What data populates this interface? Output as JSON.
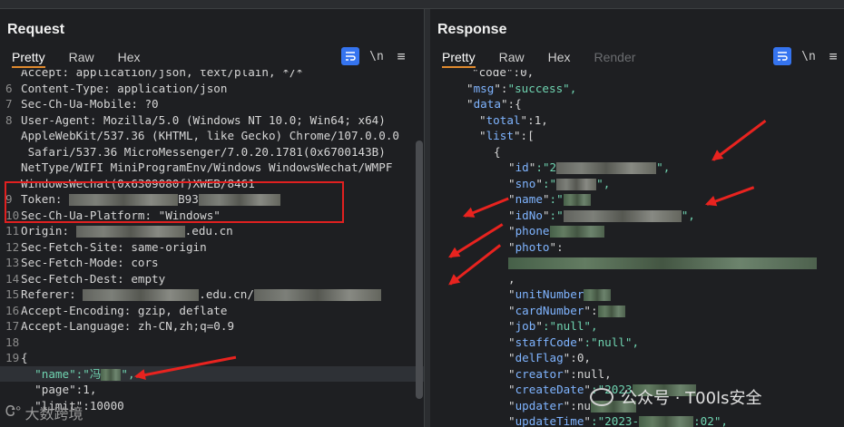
{
  "request": {
    "title": "Request",
    "tabs": [
      "Pretty",
      "Raw",
      "Hex"
    ],
    "active_tab": "Pretty",
    "icons": {
      "wrap": "wrap-icon",
      "newline": "\\n",
      "menu": "≡"
    },
    "lines": [
      {
        "n": "",
        "text": "Accept: application/json, text/plain, */*"
      },
      {
        "n": "6",
        "text": "Content-Type: application/json"
      },
      {
        "n": "7",
        "text": "Sec-Ch-Ua-Mobile: ?0"
      },
      {
        "n": "8",
        "text": "User-Agent: Mozilla/5.0 (Windows NT 10.0; Win64; x64)"
      },
      {
        "n": "",
        "text": "AppleWebKit/537.36 (KHTML, like Gecko) Chrome/107.0.0.0"
      },
      {
        "n": "",
        "text": " Safari/537.36 MicroMessenger/7.0.20.1781(0x6700143B)"
      },
      {
        "n": "",
        "text": "NetType/WIFI MiniProgramEnv/Windows WindowsWechat/WMPF"
      },
      {
        "n": "",
        "text": "WindowsWechat(0x6309080f)XWEB/8461"
      },
      {
        "n": "9",
        "text": "Token: "
      },
      {
        "n": "10",
        "text": "Sec-Ch-Ua-Platform: \"Windows\""
      },
      {
        "n": "11",
        "text": "Origin: "
      },
      {
        "n": "12",
        "text": "Sec-Fetch-Site: same-origin"
      },
      {
        "n": "13",
        "text": "Sec-Fetch-Mode: cors"
      },
      {
        "n": "14",
        "text": "Sec-Fetch-Dest: empty"
      },
      {
        "n": "15",
        "text": "Referer: "
      },
      {
        "n": "16",
        "text": "Accept-Encoding: gzip, deflate"
      },
      {
        "n": "17",
        "text": "Accept-Language: zh-CN,zh;q=0.9"
      },
      {
        "n": "18",
        "text": ""
      },
      {
        "n": "19",
        "text": "{"
      },
      {
        "n": "",
        "text": "  \"name\":\"冯"
      },
      {
        "n": "",
        "text": "  \"page\":1,"
      },
      {
        "n": "",
        "text": "  \"limit\":10000"
      }
    ],
    "origin_suffix": ".edu.cn",
    "referer_suffix": ".edu.cn/",
    "token_fragment": "B93"
  },
  "response": {
    "title": "Response",
    "tabs": [
      "Pretty",
      "Raw",
      "Hex",
      "Render"
    ],
    "active_tab": "Pretty",
    "lines": [
      {
        "indent": 2,
        "text": "\"code\":0,"
      },
      {
        "indent": 2,
        "key": "msg",
        "value": "\"success\","
      },
      {
        "indent": 2,
        "key": "data",
        "value": ":{"
      },
      {
        "indent": 4,
        "key": "total",
        "value": ":1,"
      },
      {
        "indent": 4,
        "key": "list",
        "value": ":["
      },
      {
        "indent": 6,
        "text": "{"
      },
      {
        "indent": 8,
        "key": "id",
        "value": ":\"2"
      },
      {
        "indent": 8,
        "key": "sno",
        "value": ":\""
      },
      {
        "indent": 8,
        "key": "name",
        "value": ":\""
      },
      {
        "indent": 8,
        "key": "idNo",
        "value": ":\""
      },
      {
        "indent": 8,
        "key": "phone",
        "value": ""
      },
      {
        "indent": 8,
        "key": "photo",
        "value": ":"
      },
      {
        "indent": 8,
        "text": ""
      },
      {
        "indent": 8,
        "text": ","
      },
      {
        "indent": 8,
        "key": "unitNumber",
        "value": ""
      },
      {
        "indent": 8,
        "key": "cardNumber",
        "value": ":"
      },
      {
        "indent": 8,
        "key": "job",
        "value": ":\"null\","
      },
      {
        "indent": 8,
        "key": "staffCode",
        "value": ":\"null\","
      },
      {
        "indent": 8,
        "key": "delFlag",
        "value": ":0,"
      },
      {
        "indent": 8,
        "key": "creator",
        "value": ":null,"
      },
      {
        "indent": 8,
        "key": "createDate",
        "value": ":\"2023"
      },
      {
        "indent": 8,
        "key": "updater",
        "value": ":nu"
      },
      {
        "indent": 8,
        "key": "updateTime",
        "value": ":\"2023-"
      }
    ],
    "update_suffix": ":02\","
  },
  "watermark_left": "大数跨境",
  "watermark_right": "公众号 · T00ls安全",
  "colors": {
    "accent": "#e08a2e",
    "key": "#7fb4ff",
    "string": "#6fd3b0",
    "highlight": "#e02020"
  }
}
